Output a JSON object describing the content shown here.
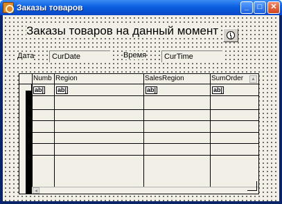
{
  "window": {
    "title": "Заказы товаров",
    "minimize_glyph": "_",
    "maximize_glyph": "□",
    "close_glyph": "✕"
  },
  "form": {
    "heading": "Заказы товаров на данный момент",
    "date_label": "Дата",
    "date_value": "CurDate",
    "time_label": "Время",
    "time_value": "CurTime",
    "report_button_icon": "clock-icon"
  },
  "grid": {
    "columns": [
      "Numb",
      "Region",
      "SalesRegion",
      "SumOrder"
    ],
    "cell_placeholder": "ab|",
    "scroll_up_glyph": "▲",
    "scroll_left_glyph": "◄"
  }
}
